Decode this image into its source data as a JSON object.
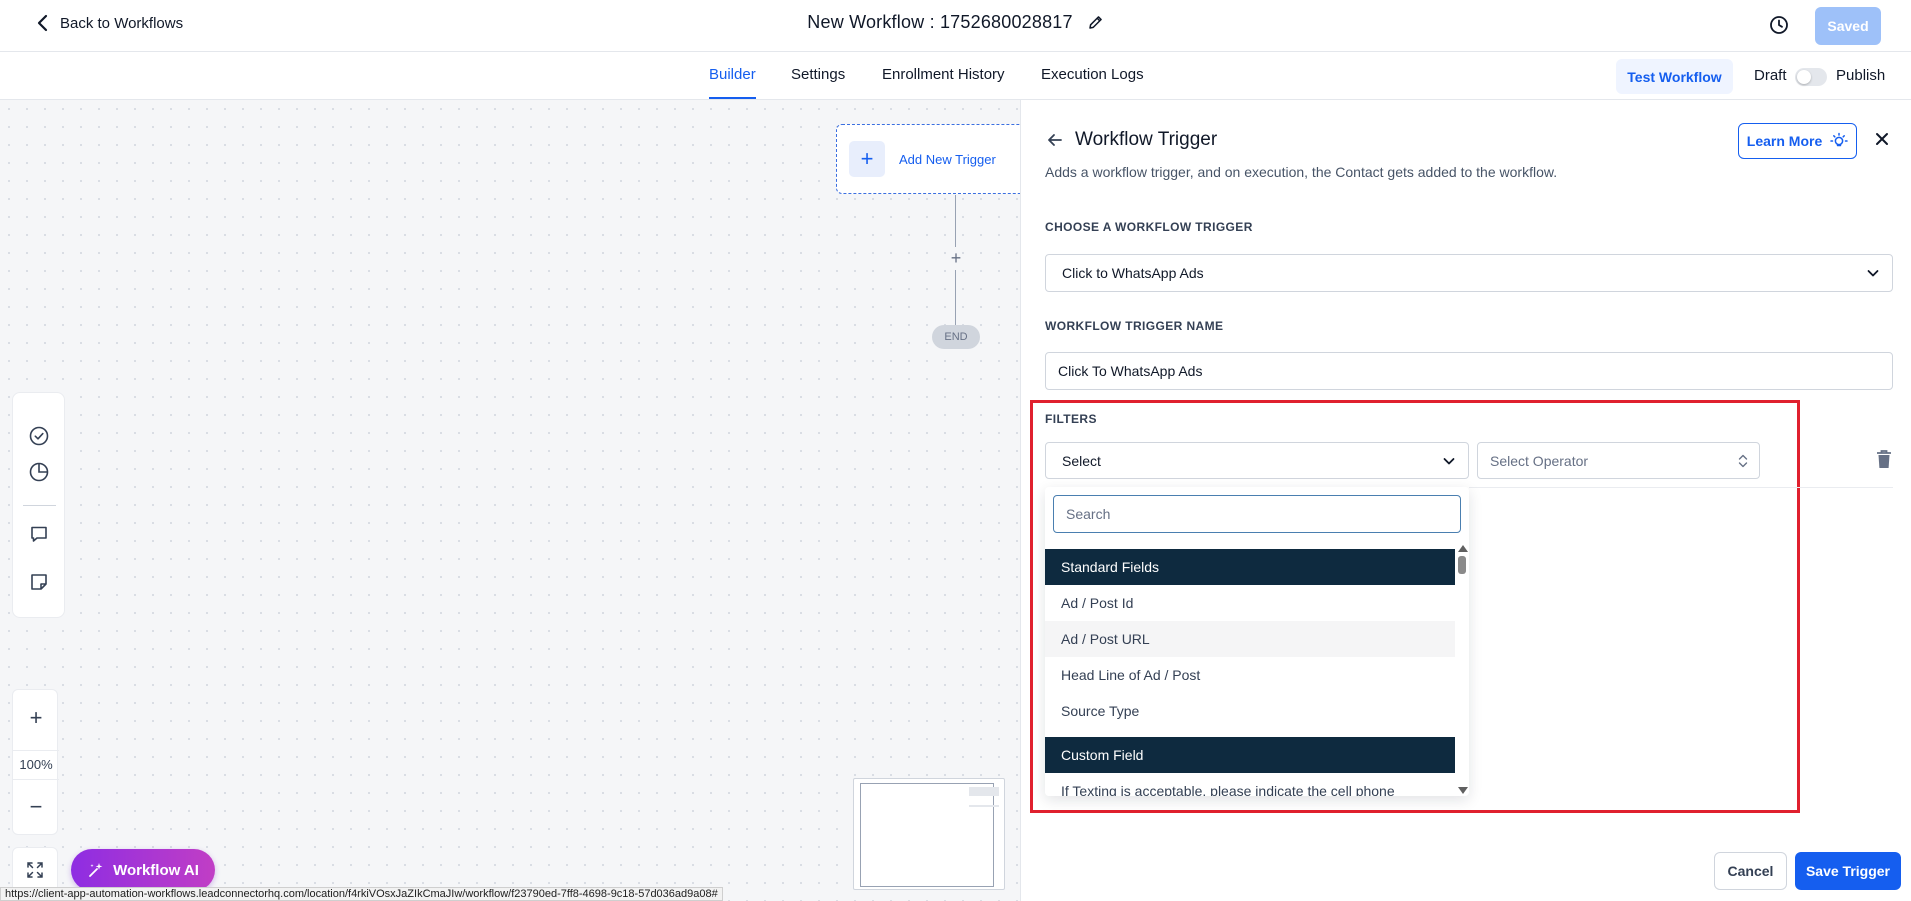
{
  "header": {
    "back_label": "Back to Workflows",
    "title": "New Workflow : 1752680028817",
    "saved_label": "Saved"
  },
  "tabs": [
    {
      "label": "Builder",
      "active": true
    },
    {
      "label": "Settings",
      "active": false
    },
    {
      "label": "Enrollment History",
      "active": false
    },
    {
      "label": "Execution Logs",
      "active": false
    }
  ],
  "actions": {
    "test_label": "Test Workflow",
    "draft_label": "Draft",
    "publish_label": "Publish",
    "published": false
  },
  "canvas": {
    "add_trigger_label": "Add New Trigger",
    "add_step_symbol": "+",
    "end_label": "END",
    "zoom_in_symbol": "+",
    "zoom_level": "100%",
    "zoom_out_symbol": "−",
    "ai_button_label": "Workflow AI",
    "status_url": "https://client-app-automation-workflows.leadconnectorhq.com/location/f4rkiVOsxJaZIkCmaJIw/workflow/f23790ed-7ff8-4698-9c18-57d036ad9a08#"
  },
  "panel": {
    "title": "Workflow Trigger",
    "description": "Adds a workflow trigger, and on execution, the Contact gets added to the workflow.",
    "learn_more_label": "Learn More",
    "trigger_section_label": "CHOOSE A WORKFLOW TRIGGER",
    "trigger_value": "Click to WhatsApp Ads",
    "name_section_label": "WORKFLOW TRIGGER NAME",
    "name_value": "Click To WhatsApp Ads",
    "filters_label": "FILTERS",
    "filter_field_value": "Select",
    "operator_placeholder": "Select Operator",
    "search_placeholder": "Search",
    "dropdown": {
      "group_standard": "Standard Fields",
      "standard_items": [
        "Ad / Post Id",
        "Ad / Post URL",
        "Head Line of Ad / Post",
        "Source Type"
      ],
      "group_custom": "Custom Field",
      "custom_items": [
        "If Texting is acceptable, please indicate the cell phone"
      ]
    },
    "cancel_label": "Cancel",
    "save_label": "Save Trigger"
  },
  "colors": {
    "accent": "#155eef",
    "highlight_border": "#e0202e",
    "dropdown_group_bg": "#0e2a3f"
  }
}
